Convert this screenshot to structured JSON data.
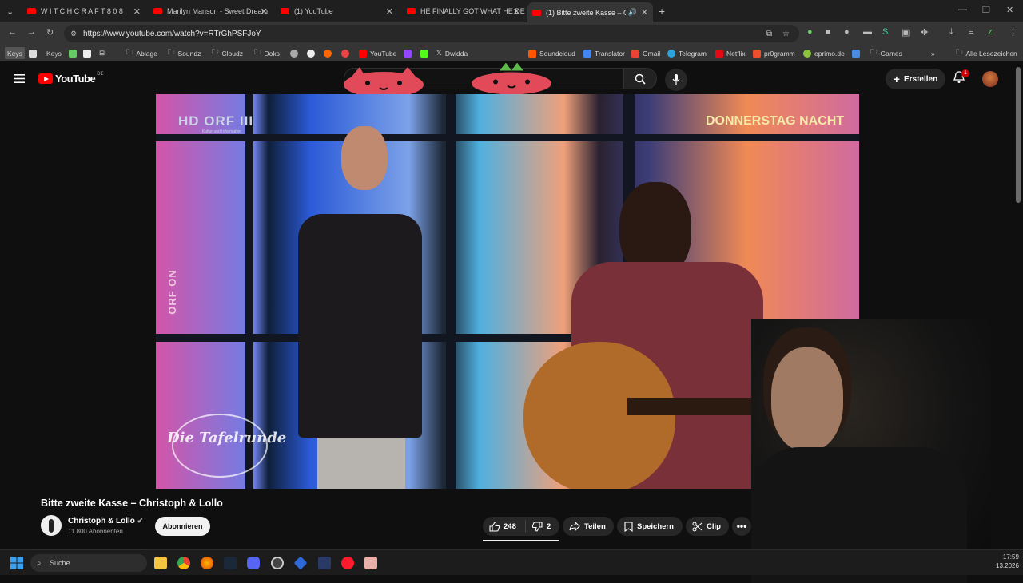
{
  "tabs": [
    {
      "title": "W I T C H C R A F T  8 0 8"
    },
    {
      "title": "Marilyn Manson - Sweet Dream"
    },
    {
      "title": "(1) YouTube"
    },
    {
      "title": "HE FINALLY GOT WHAT HE DES"
    },
    {
      "title": "(1) Bitte zweite Kasse – Chri"
    }
  ],
  "address": {
    "url": "https://www.youtube.com/watch?v=RTrGhPSFJoY"
  },
  "bookmarks": [
    "Keys",
    "Keys",
    "Ablage",
    "Soundz",
    "Cloudz",
    "Doks",
    "YouTube",
    "Dwidda",
    "Soundcloud",
    "Translator",
    "Gmail",
    "Telegram",
    "Netflix",
    "pr0gramm",
    "eprimo.de",
    "Games",
    "Alle Lesezeichen"
  ],
  "youtube": {
    "logo": "YouTube",
    "region": "DE",
    "create": "Erstellen",
    "notifications": "1",
    "video": {
      "overlay_top_right": "DONNERSTAG NACHT",
      "overlay_logo": "HD ORF III",
      "overlay_sub": "Kultur und Information",
      "overlay_left": "ORF ON",
      "overlay_bottom": "Die Tafelrunde"
    },
    "title": "Bitte zweite Kasse – Christoph & Lollo",
    "channel": {
      "name": "Christoph & Lollo",
      "subscribers": "11.800 Abonnenten",
      "subscribe": "Abonnieren"
    },
    "actions": {
      "likes": "248",
      "dislikes": "2",
      "share": "Teilen",
      "save": "Speichern",
      "clip": "Clip"
    }
  },
  "taskbar": {
    "search": "Suche",
    "time": "17:59",
    "date": "13.2026"
  },
  "colors": {
    "accent": "#ff0000",
    "bg": "#0f0f0f"
  }
}
